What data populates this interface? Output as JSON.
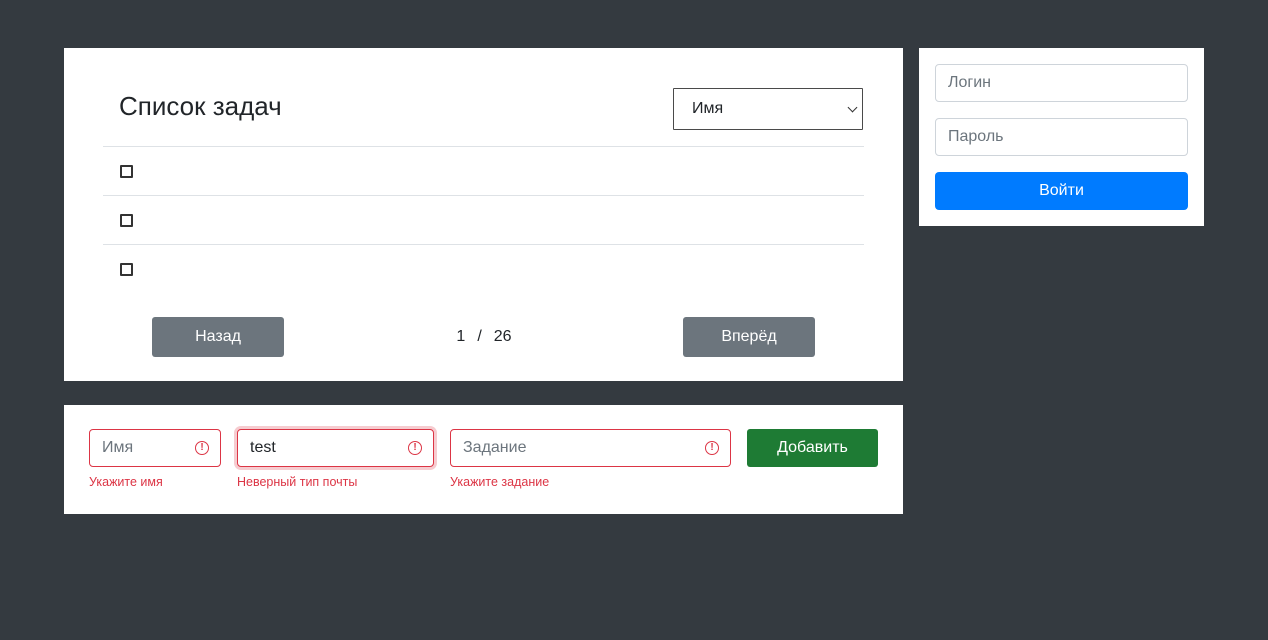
{
  "tasks": {
    "title": "Список задач",
    "sort_select": {
      "selected": "Имя"
    },
    "rows": [
      {
        "checked": false
      },
      {
        "checked": false
      },
      {
        "checked": false
      }
    ],
    "back_label": "Назад",
    "next_label": "Вперёд",
    "page_current": "1",
    "page_separator": "/",
    "page_total": "26"
  },
  "login": {
    "login_placeholder": "Логин",
    "password_placeholder": "Пароль",
    "submit_label": "Войти"
  },
  "add_task": {
    "name_placeholder": "Имя",
    "name_error": "Укажите имя",
    "email_value": "test",
    "email_error": "Неверный тип почты",
    "task_placeholder": "Задание",
    "task_error": "Укажите задание",
    "error_icon_glyph": "!",
    "submit_label": "Добавить"
  },
  "colors": {
    "page_bg": "#343a40",
    "primary": "#007bff",
    "secondary": "#6c757d",
    "success": "#1e7b34",
    "danger": "#dc3545"
  },
  "icons": {
    "sort_select": "chevron-down-icon",
    "checkbox": "checkbox-icon",
    "field_error": "alert-circle-icon"
  }
}
